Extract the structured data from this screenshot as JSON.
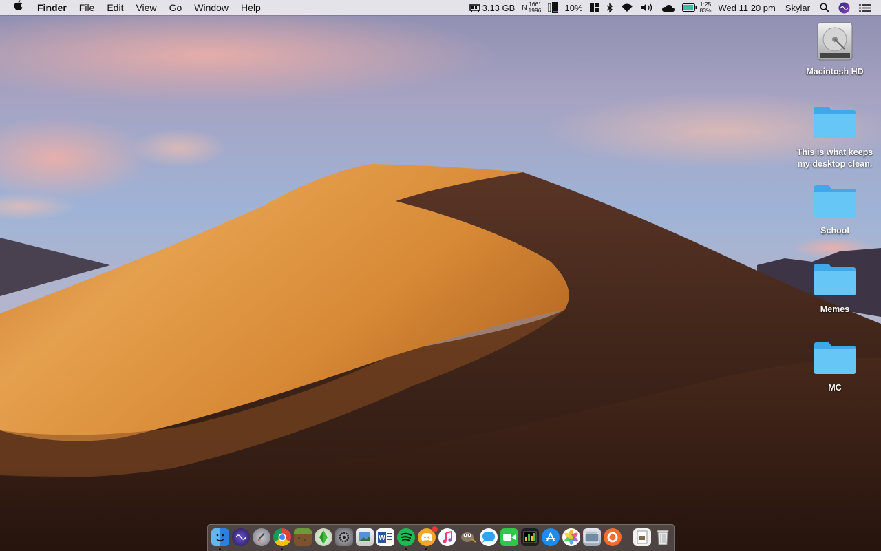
{
  "menubar": {
    "apple_icon": "apple-logo-icon",
    "app_name": "Finder",
    "menus": [
      "File",
      "Edit",
      "View",
      "Go",
      "Window",
      "Help"
    ],
    "status": {
      "memory": "3.13 GB",
      "temp_top": "166°",
      "temp_bottom": "1996",
      "cpu_letters": "N",
      "battery_percent_left": "10%",
      "time_top": "1:25",
      "time_bottom": "83%",
      "clock": "Wed 11 20 pm",
      "user": "Skylar"
    }
  },
  "desktop": {
    "items": [
      {
        "label": "Macintosh HD",
        "icon": "hard-drive-icon"
      },
      {
        "label": "This is what keeps\nmy desktop clean.",
        "icon": "folder-icon"
      },
      {
        "label": "School",
        "icon": "folder-icon"
      },
      {
        "label": "Memes",
        "icon": "folder-icon"
      },
      {
        "label": "MC",
        "icon": "folder-icon"
      }
    ]
  },
  "dock": {
    "apps": [
      {
        "name": "finder",
        "color": "#3b8fe8"
      },
      {
        "name": "siri",
        "color": "#3a2a6e"
      },
      {
        "name": "launchpad",
        "color": "#8c8c94"
      },
      {
        "name": "chrome",
        "color": "#db4437"
      },
      {
        "name": "minecraft",
        "color": "#6a9b3a"
      },
      {
        "name": "sims",
        "color": "#4ec140"
      },
      {
        "name": "system-preferences",
        "color": "#7f7f86"
      },
      {
        "name": "preview",
        "color": "#5a8fd6"
      },
      {
        "name": "word",
        "color": "#2b5797"
      },
      {
        "name": "spotify",
        "color": "#1db954"
      },
      {
        "name": "discord",
        "color": "#f5a623"
      },
      {
        "name": "itunes",
        "color": "#f05a9d"
      },
      {
        "name": "gimp",
        "color": "#6b5a42"
      },
      {
        "name": "messages",
        "color": "#2fa3f5"
      },
      {
        "name": "facetime",
        "color": "#2ec84a"
      },
      {
        "name": "activity-monitor",
        "color": "#2a2a2a"
      },
      {
        "name": "app-store",
        "color": "#1d8bf1"
      },
      {
        "name": "photos",
        "color": "#f2c14e"
      },
      {
        "name": "image-capture",
        "color": "#6f8aa3"
      },
      {
        "name": "origin",
        "color": "#f56c2d"
      },
      {
        "name": "documents",
        "color": "#d8d8d8"
      },
      {
        "name": "trash",
        "color": "#c9c9c9"
      }
    ]
  }
}
